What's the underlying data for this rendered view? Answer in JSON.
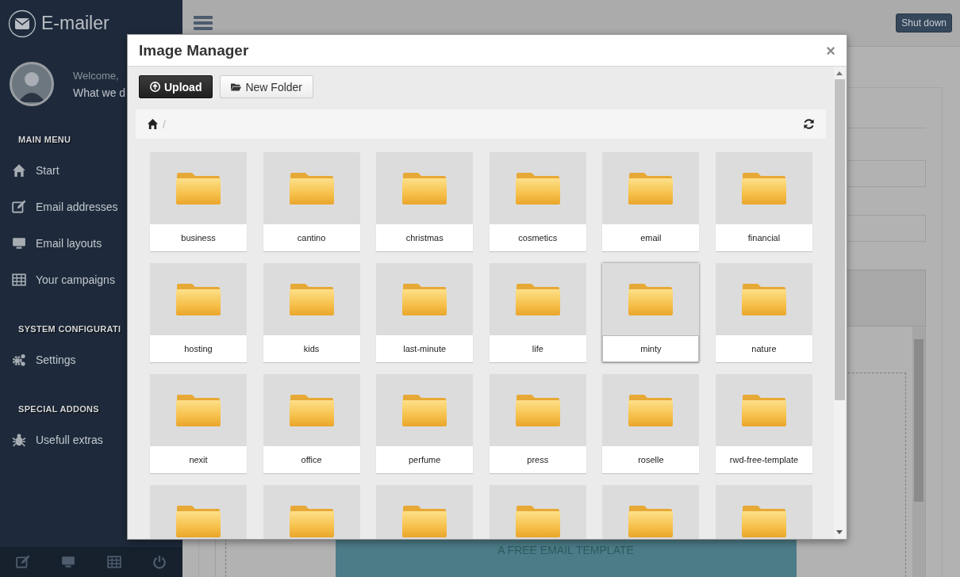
{
  "sidebar": {
    "brand": "E-mailer",
    "welcome": "Welcome,",
    "user_line": "What we d",
    "sections": [
      {
        "title": "MAIN MENU",
        "items": [
          {
            "label": "Start"
          },
          {
            "label": "Email addresses"
          },
          {
            "label": "Email layouts"
          },
          {
            "label": "Your campaigns"
          }
        ]
      },
      {
        "title": "SYSTEM CONFIGURATI",
        "items": [
          {
            "label": "Settings"
          }
        ]
      },
      {
        "title": "SPECIAL ADDONS",
        "items": [
          {
            "label": "Usefull extras"
          }
        ]
      }
    ]
  },
  "header": {
    "shutdown_button": "Shut down"
  },
  "background": {
    "template_text": "A FREE EMAIL TEMPLATE"
  },
  "modal": {
    "title": "Image Manager",
    "close": "×",
    "buttons": [
      {
        "label": "Upload",
        "kind": "primary"
      },
      {
        "label": "New Folder",
        "kind": "default"
      }
    ],
    "breadcrumb_separator": "/",
    "folders": [
      {
        "name": "business",
        "selected": false
      },
      {
        "name": "cantino",
        "selected": false
      },
      {
        "name": "christmas",
        "selected": false
      },
      {
        "name": "cosmetics",
        "selected": false
      },
      {
        "name": "email",
        "selected": false
      },
      {
        "name": "financial",
        "selected": false
      },
      {
        "name": "hosting",
        "selected": false
      },
      {
        "name": "kids",
        "selected": false
      },
      {
        "name": "last-minute",
        "selected": false
      },
      {
        "name": "life",
        "selected": false
      },
      {
        "name": "minty",
        "selected": true
      },
      {
        "name": "nature",
        "selected": false
      },
      {
        "name": "nexit",
        "selected": false
      },
      {
        "name": "office",
        "selected": false
      },
      {
        "name": "perfume",
        "selected": false
      },
      {
        "name": "press",
        "selected": false
      },
      {
        "name": "roselle",
        "selected": false
      },
      {
        "name": "rwd-free-template",
        "selected": false
      },
      {
        "selected": false
      },
      {
        "selected": false
      },
      {
        "selected": false
      },
      {
        "selected": false
      },
      {
        "selected": false
      },
      {
        "selected": false
      }
    ]
  }
}
